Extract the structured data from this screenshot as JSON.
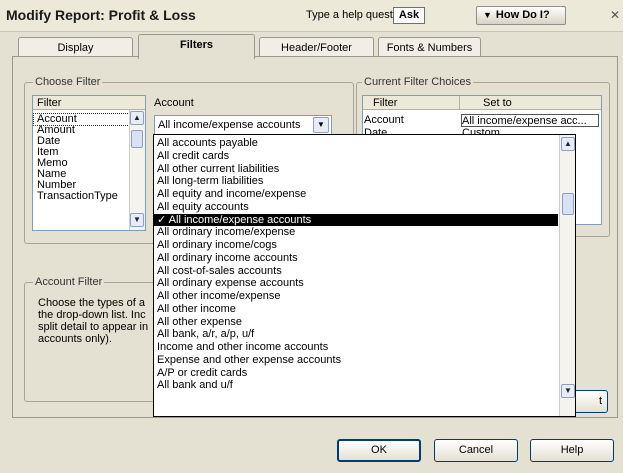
{
  "window": {
    "title": "Modify Report: Profit & Loss",
    "help_prompt": "Type a help question",
    "ask_label": "Ask",
    "howdoi_label": "How Do I?",
    "close_glyph": "✕"
  },
  "tabs": [
    {
      "label": "Display",
      "active": false
    },
    {
      "label": "Filters",
      "active": true
    },
    {
      "label": "Header/Footer",
      "active": false
    },
    {
      "label": "Fonts & Numbers",
      "active": false
    }
  ],
  "choose_filter": {
    "group_label": "Choose Filter",
    "list_header": "Filter",
    "items": [
      "Account",
      "Amount",
      "Date",
      "Item",
      "Memo",
      "Name",
      "Number",
      "TransactionType"
    ],
    "selected_index": 0,
    "account_label": "Account",
    "account_value": "All income/expense accounts"
  },
  "current_filter_choices": {
    "group_label": "Current Filter Choices",
    "col_filter": "Filter",
    "col_set_to": "Set to",
    "rows": [
      {
        "filter": "Account",
        "set_to": "All income/expense acc..."
      },
      {
        "filter": "Date",
        "set_to": "Custom"
      }
    ]
  },
  "account_filter": {
    "group_label": "Account Filter",
    "lines": [
      "Choose the types of a",
      "the drop-down list. Inc",
      "split detail to appear in",
      "accounts only)."
    ]
  },
  "dropdown": {
    "selected_index": 6,
    "check_glyph": "✓",
    "items": [
      "All accounts payable",
      "All credit cards",
      "All other current liabilities",
      "All long-term liabilities",
      "All equity and income/expense",
      "All equity accounts",
      "All income/expense accounts",
      "All ordinary income/expense",
      "All ordinary income/cogs",
      "All ordinary income accounts",
      "All cost-of-sales accounts",
      "All ordinary expense accounts",
      "All other income/expense",
      "All other income",
      "All other expense",
      "All bank, a/r, a/p, u/f",
      "Income and other income accounts",
      "Expense and other expense accounts",
      "A/P or credit cards",
      "All bank and u/f"
    ]
  },
  "partial_button_label": "t",
  "buttons": {
    "ok": "OK",
    "cancel": "Cancel",
    "help": "Help"
  }
}
